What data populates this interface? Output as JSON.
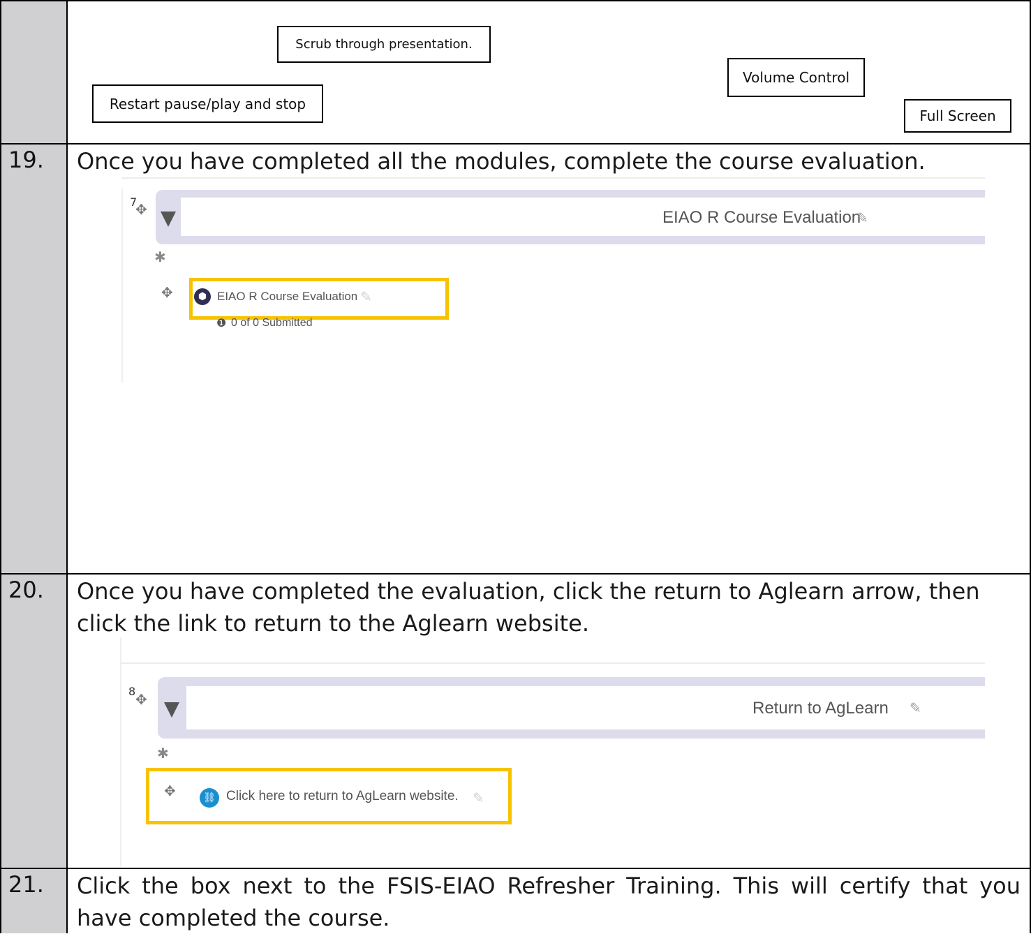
{
  "callouts": {
    "scrub": "Scrub through presentation.",
    "volume": "Volume Control",
    "restart": "Restart pause/play and stop",
    "fullscreen": "Full Screen"
  },
  "steps": [
    {
      "number": "19.",
      "text": "Once you have completed all the modules, complete the course evaluation."
    },
    {
      "number": "20.",
      "text": "Once you have completed the evaluation, click the return to Aglearn arrow, then click the link to return to the Aglearn website."
    },
    {
      "number": "21.",
      "text": "Click the box next to the FSIS-EIAO Refresher Training. This will certify that you have completed the course."
    }
  ],
  "screenshot19": {
    "section_number": "7",
    "section_title": "EIAO R Course Evaluation",
    "activity_name": "EIAO R Course Evaluation",
    "status": "0 of 0 Submitted",
    "icons": {
      "move": "move-icon",
      "collapse": "collapse-triangle-icon",
      "edit": "pencil-icon",
      "settings": "gear-icon",
      "activity": "feedback-icon",
      "info": "info-icon"
    },
    "highlight_color": "#f7c300"
  },
  "screenshot20": {
    "section_number": "8",
    "section_title": "Return to AgLearn",
    "activity_name": "Click here to return to AgLearn website.",
    "icons": {
      "move": "move-icon",
      "collapse": "collapse-triangle-icon",
      "edit": "pencil-icon",
      "settings": "gear-icon",
      "activity": "link-icon"
    },
    "highlight_color": "#f7c300"
  }
}
